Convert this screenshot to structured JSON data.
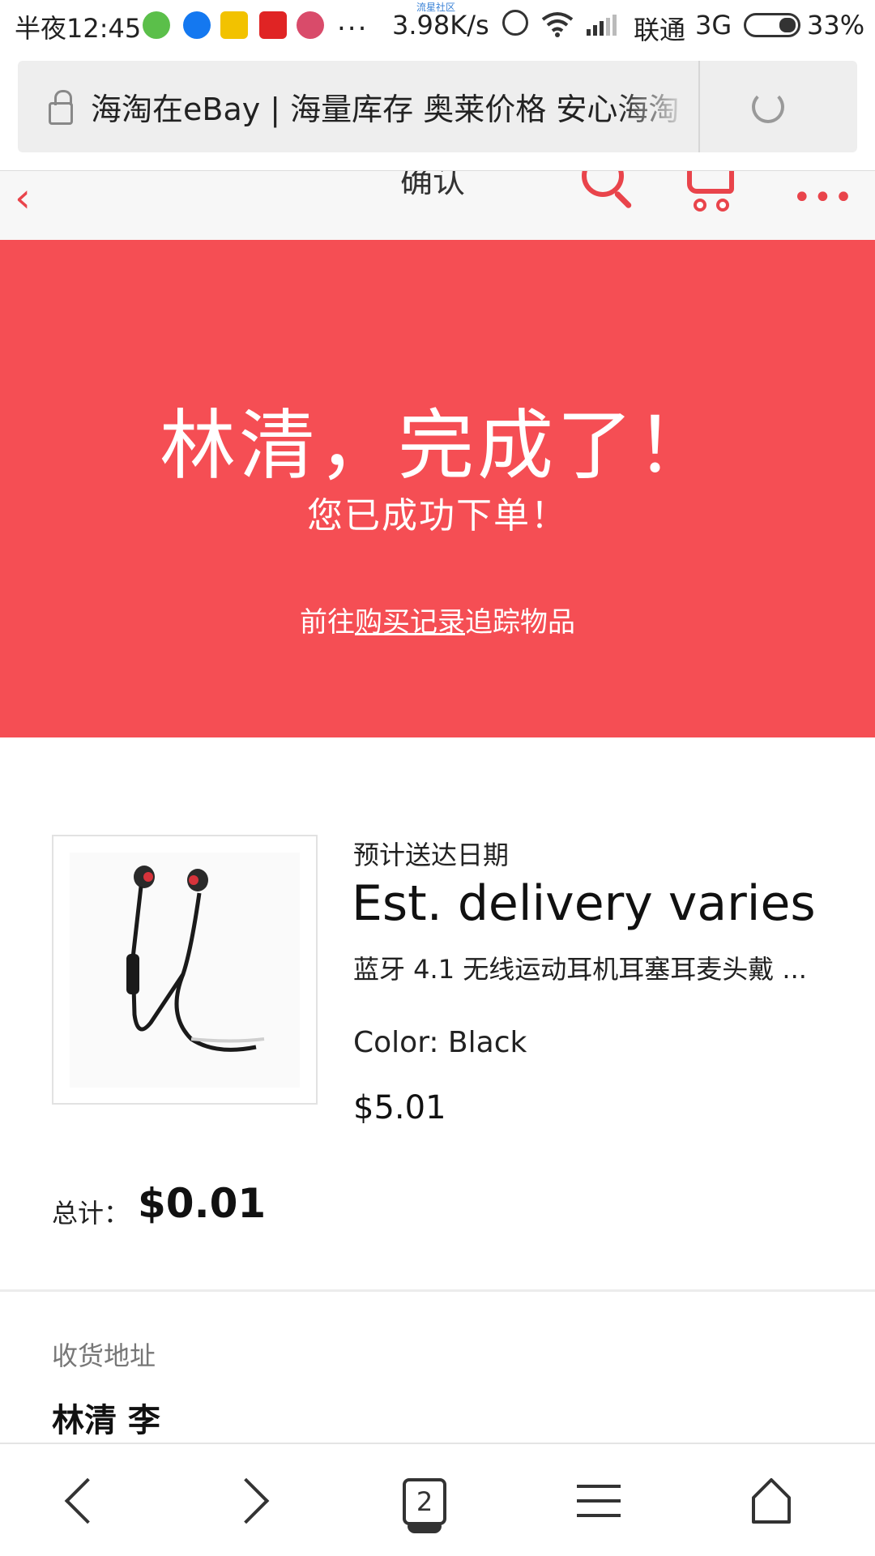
{
  "status_bar": {
    "time": "半夜12:45",
    "overflow": "...",
    "tiny_label": "流星社区",
    "speed": "3.98K/s",
    "carrier": "联通",
    "network": "3G",
    "battery": "33%"
  },
  "browser": {
    "page_title": "海淘在eBay | 海量库存 奥莱价格 安心海淘"
  },
  "header": {
    "title": "确认",
    "back_icon": "chevron-left-icon",
    "search_icon": "search-icon",
    "cart_icon": "cart-icon",
    "more_icon": "more-icon"
  },
  "hero": {
    "title": "林清，完成了！",
    "subtitle": "您已成功下单！",
    "track_prefix": "前往",
    "track_link": "购买记录",
    "track_suffix": "追踪物品"
  },
  "item": {
    "delivery_label": "预计送达日期",
    "delivery_value": "Est. delivery varies",
    "title": "蓝牙 4.1 无线运动耳机耳塞耳麦头戴 ...",
    "color": "Color: Black",
    "price": "$5.01"
  },
  "total": {
    "label": "总计：",
    "value": "$0.01"
  },
  "shipping": {
    "label": "收货地址",
    "name": "林清 李"
  },
  "bottom_nav": {
    "tab_count": "2"
  },
  "colors": {
    "accent": "#e9444b",
    "hero_bg": "#f54e54"
  }
}
